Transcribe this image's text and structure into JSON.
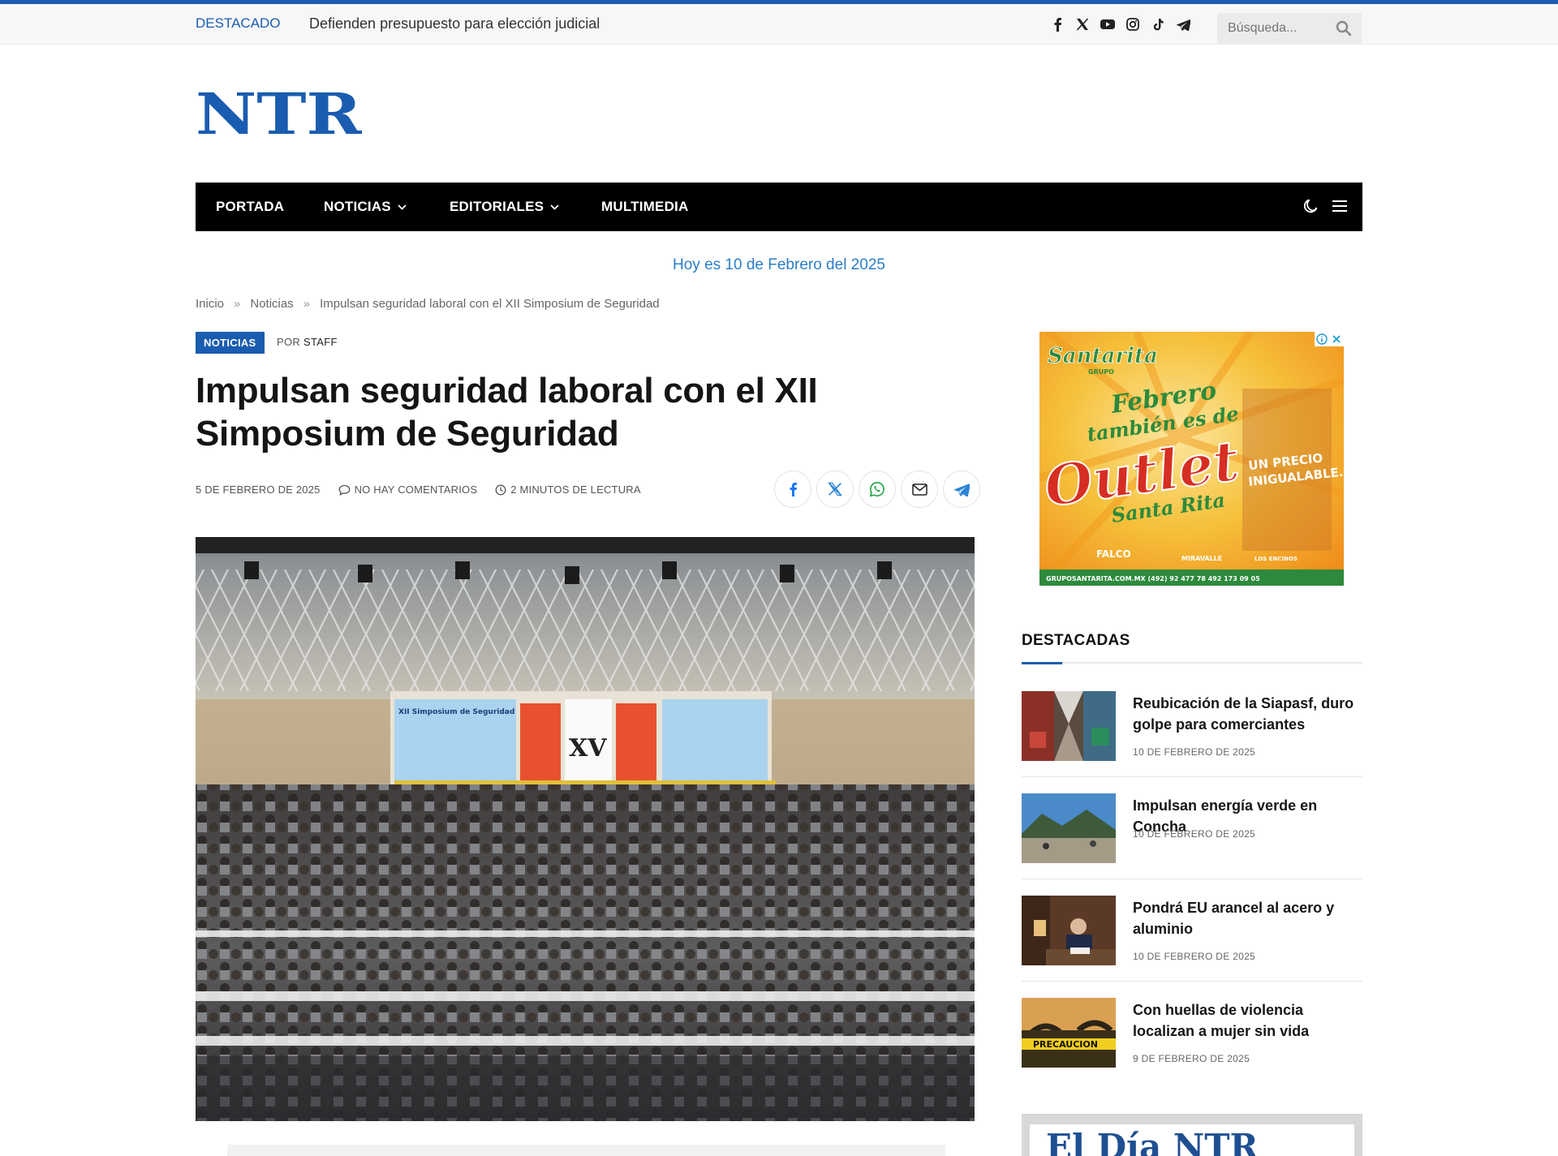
{
  "topbar": {
    "featured_label": "DESTACADO",
    "featured_text": "Defienden presupuesto para elección judicial",
    "social_icons": [
      "facebook-icon",
      "x-icon",
      "youtube-icon",
      "instagram-icon",
      "tiktok-icon",
      "telegram-icon"
    ],
    "search_placeholder": "Búsqueda..."
  },
  "logo": {
    "text": "NTR",
    "color": "#1a5cb0"
  },
  "nav": {
    "items": [
      {
        "label": "PORTADA",
        "has_dropdown": false
      },
      {
        "label": "NOTICIAS",
        "has_dropdown": true
      },
      {
        "label": "EDITORIALES",
        "has_dropdown": true
      },
      {
        "label": "MULTIMEDIA",
        "has_dropdown": false
      }
    ],
    "tools": [
      "moon-icon",
      "menu-icon"
    ]
  },
  "date_line": "Hoy es 10 de Febrero del 2025",
  "breadcrumb": {
    "items": [
      "Inicio",
      "Noticias",
      "Impulsan seguridad laboral con el XII Simposium de Seguridad"
    ],
    "separator": "»"
  },
  "article": {
    "category": "NOTICIAS",
    "by_prefix": "POR",
    "author": "STAFF",
    "title": "Impulsan seguridad laboral con el XII Simposium de Seguridad",
    "date": "5 DE FEBRERO DE 2025",
    "comments": "NO HAY COMENTARIOS",
    "reading_time": "2 MINUTOS DE LECTURA",
    "share_icons": [
      "facebook-icon",
      "x-icon",
      "whatsapp-icon",
      "email-icon",
      "telegram-icon"
    ],
    "hero_screen_text": "XII Simposium de Seguridad",
    "hero_center_text": "XV"
  },
  "ad": {
    "brand": "Santarita",
    "brand_sub": "GRUPO",
    "line1": "Febrero",
    "line2": "también es de",
    "headline": "Outlet",
    "script": "Santa Rita",
    "tag1": "UN PRECIO",
    "tag2": "INIGUALABLE...",
    "partners": [
      "FALCO",
      "MIRAVALLE",
      "LOS ENCINOS"
    ],
    "footer": "GRUPOSANTARITA.COM.MX   (492) 92 477 78   492 173 09 05"
  },
  "sidebar": {
    "title": "DESTACADAS",
    "items": [
      {
        "title": "Reubicación de la Siapasf, duro golpe para comerciantes",
        "date": "10 DE FEBRERO DE 2025"
      },
      {
        "title": "Impulsan energía verde en Concha",
        "date": "10 DE FEBRERO DE 2025"
      },
      {
        "title": "Pondrá EU arancel al acero y aluminio",
        "date": "10 DE FEBRERO DE 2025"
      },
      {
        "title": "Con huellas de violencia localizan a mujer sin vida",
        "date": "9 DE FEBRERO DE 2025",
        "thumb_text": "PRECAUCION"
      }
    ],
    "promo_text": "El Día  NTR"
  }
}
